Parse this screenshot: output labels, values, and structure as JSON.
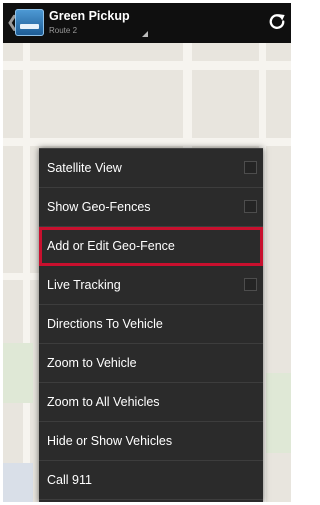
{
  "header": {
    "title": "Green Pickup",
    "subtitle": "Route 2",
    "back_icon": "chevron-left-icon",
    "app_icon": "vehicle-app-icon",
    "dropdown_icon": "dropdown-corner-icon",
    "refresh_icon": "refresh-icon"
  },
  "menu": {
    "items": [
      {
        "label": "Satellite View",
        "checkbox": true,
        "checked": false
      },
      {
        "label": "Show Geo-Fences",
        "checkbox": true,
        "checked": false
      },
      {
        "label": "Add or Edit Geo-Fence",
        "checkbox": false,
        "highlighted": true
      },
      {
        "label": "Live Tracking",
        "checkbox": true,
        "checked": false
      },
      {
        "label": "Directions To Vehicle",
        "checkbox": false
      },
      {
        "label": "Zoom to Vehicle",
        "checkbox": false
      },
      {
        "label": "Zoom to All Vehicles",
        "checkbox": false
      },
      {
        "label": "Hide or Show Vehicles",
        "checkbox": false
      },
      {
        "label": "Call 911",
        "checkbox": false
      }
    ]
  },
  "colors": {
    "actionbar": "#0f0f0f",
    "menu_background": "#2b2b2b",
    "highlight_border": "#c8102e",
    "map_background": "#e8e5de"
  }
}
